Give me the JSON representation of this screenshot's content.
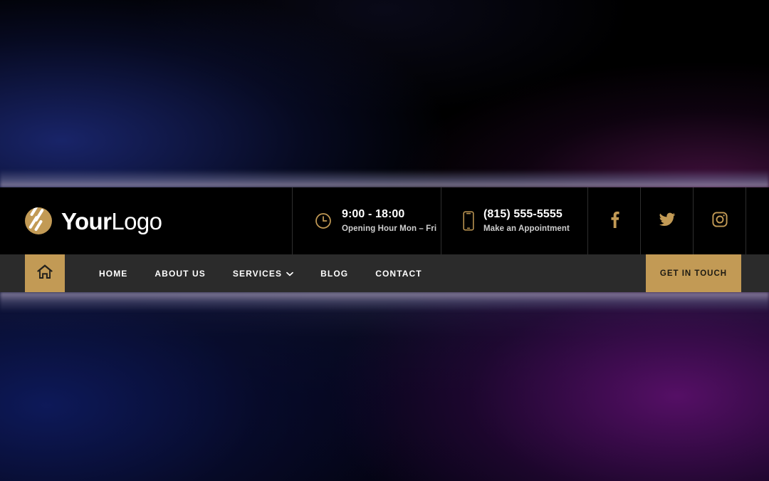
{
  "theme": {
    "gold": "#c29a55",
    "header_bg": "#000000",
    "nav_bg": "#2b2b2b",
    "text_light": "#ffffff",
    "divider": "#2e2e2e"
  },
  "header": {
    "brand": {
      "logo_icon": "slash-circle-logo-icon",
      "name_bold": "Your",
      "name_light": "Logo"
    },
    "hours": {
      "icon": "clock-icon",
      "value": "9:00 - 18:00",
      "label": "Opening Hour Mon – Fri"
    },
    "phone": {
      "icon": "mobile-phone-icon",
      "value": "(815) 555-5555",
      "label": "Make an Appointment"
    },
    "socials": [
      {
        "name": "facebook",
        "icon": "facebook-icon"
      },
      {
        "name": "twitter",
        "icon": "twitter-icon"
      },
      {
        "name": "instagram",
        "icon": "instagram-icon"
      }
    ]
  },
  "nav": {
    "home_button_icon": "house-icon",
    "items": [
      {
        "label": "HOME",
        "has_dropdown": false
      },
      {
        "label": "ABOUT US",
        "has_dropdown": false
      },
      {
        "label": "SERVICES",
        "has_dropdown": true
      },
      {
        "label": "BLOG",
        "has_dropdown": false
      },
      {
        "label": "CONTACT",
        "has_dropdown": false
      }
    ],
    "cta_label": "GET IN TOUCH"
  }
}
